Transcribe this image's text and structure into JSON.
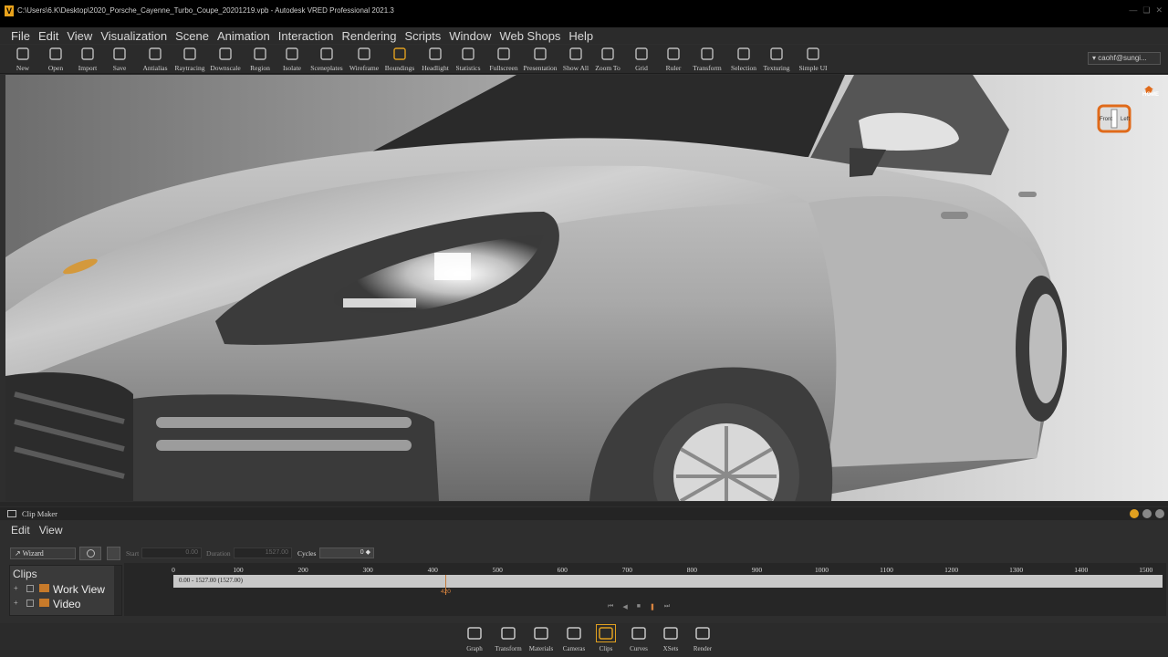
{
  "window": {
    "title": "C:\\Users\\6.K\\Desktop\\2020_Porsche_Cayenne_Turbo_Coupe_20201219.vpb - Autodesk VRED Professional 2021.3",
    "app_icon_letter": "V"
  },
  "menubar": [
    "File",
    "Edit",
    "View",
    "Visualization",
    "Scene",
    "Animation",
    "Interaction",
    "Rendering",
    "Scripts",
    "Window",
    "Web Shops",
    "Help"
  ],
  "toolbar": [
    {
      "label": "New",
      "icon": "new-file-icon"
    },
    {
      "label": "Open",
      "icon": "open-folder-icon"
    },
    {
      "label": "Import",
      "icon": "import-icon"
    },
    {
      "label": "Save",
      "icon": "save-icon"
    },
    {
      "label": "Antialias",
      "icon": "antialias-icon"
    },
    {
      "label": "Raytracing",
      "icon": "raytracing-icon"
    },
    {
      "label": "Downscale",
      "icon": "downscale-icon"
    },
    {
      "label": "Region",
      "icon": "region-icon"
    },
    {
      "label": "Isolate",
      "icon": "isolate-icon"
    },
    {
      "label": "Sceneplates",
      "icon": "sceneplates-icon"
    },
    {
      "label": "Wireframe",
      "icon": "wireframe-icon"
    },
    {
      "label": "Boundings",
      "icon": "boundings-icon"
    },
    {
      "label": "Headlight",
      "icon": "headlight-icon"
    },
    {
      "label": "Statistics",
      "icon": "statistics-icon"
    },
    {
      "label": "Fullscreen",
      "icon": "fullscreen-icon"
    },
    {
      "label": "Presentation",
      "icon": "presentation-icon"
    },
    {
      "label": "Show All",
      "icon": "show-all-icon"
    },
    {
      "label": "Zoom To",
      "icon": "zoom-to-icon"
    },
    {
      "label": "Grid",
      "icon": "grid-icon"
    },
    {
      "label": "Ruler",
      "icon": "ruler-icon"
    },
    {
      "label": "Transform",
      "icon": "transform-icon"
    },
    {
      "label": "Selection",
      "icon": "selection-icon"
    },
    {
      "label": "Texturing",
      "icon": "texturing-icon"
    },
    {
      "label": "Simple UI",
      "icon": "simple-ui-icon"
    }
  ],
  "user": {
    "name": "caohf@sungi..."
  },
  "viewport": {
    "navcube_home": "HOME",
    "navcube_front": "Front",
    "navcube_left": "Left"
  },
  "clip_maker": {
    "title": "Clip Maker",
    "menu": [
      "Edit",
      "View"
    ],
    "wizard": "Wizard",
    "start_label": "Start",
    "start_value": "0.00",
    "duration_label": "Duration",
    "duration_value": "1527.00",
    "cycles_label": "Cycles",
    "cycles_value": "0",
    "tree_header": "Clips",
    "tree_items": [
      "Work View",
      "Video"
    ],
    "ruler_ticks": [
      "0",
      "100",
      "200",
      "300",
      "400",
      "500",
      "600",
      "700",
      "800",
      "900",
      "1000",
      "1100",
      "1200",
      "1300",
      "1400",
      "1500"
    ],
    "track_label": "0.00 - 1527.00 (1527.00)",
    "playhead_value": "420",
    "accent": "#d9843f"
  },
  "bottom_bar": [
    {
      "label": "Graph",
      "icon": "graph-icon"
    },
    {
      "label": "Transform",
      "icon": "transform-icon"
    },
    {
      "label": "Materials",
      "icon": "materials-icon"
    },
    {
      "label": "Cameras",
      "icon": "cameras-icon"
    },
    {
      "label": "Clips",
      "icon": "clips-icon",
      "active": true
    },
    {
      "label": "Curves",
      "icon": "curves-icon"
    },
    {
      "label": "XSets",
      "icon": "xsets-icon"
    },
    {
      "label": "Render",
      "icon": "render-icon"
    }
  ]
}
